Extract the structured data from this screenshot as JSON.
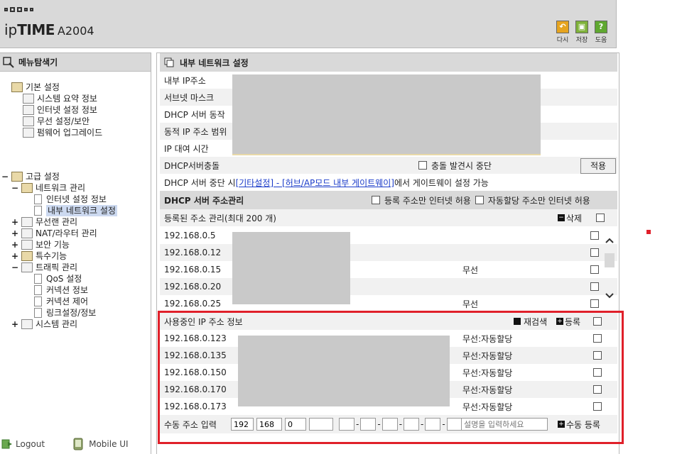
{
  "header": {
    "logo_prefix": "ip",
    "logo_bold": "TIME",
    "model": "A2004",
    "toolbar": [
      {
        "label": "다시",
        "icon": "back-icon",
        "color": "#e6a41f"
      },
      {
        "label": "저장",
        "icon": "save-icon",
        "color": "#7fb23a"
      },
      {
        "label": "도움",
        "icon": "help-icon",
        "color": "#5fa830"
      }
    ]
  },
  "sidebar": {
    "title": "메뉴탐색기",
    "basic": {
      "label": "기본 설정",
      "items": [
        "시스템 요약 정보",
        "인터넷 설정 정보",
        "무선 설정/보안",
        "펌웨어 업그레이드"
      ]
    },
    "advanced": {
      "label": "고급 설정",
      "network": "네트워크 관리",
      "network_items": [
        "인터넷 설정 정보",
        "내부 네트워크 설정"
      ],
      "groups": [
        "무선랜 관리",
        "NAT/라우터 관리",
        "보안 기능",
        "특수기능"
      ],
      "traffic": "트래픽 관리",
      "traffic_items": [
        "QoS 설정",
        "커넥션 정보",
        "커넥션 제어",
        "링크설정/정보"
      ],
      "system": "시스템 관리"
    },
    "footer": {
      "logout": "Logout",
      "mobile": "Mobile UI"
    }
  },
  "main": {
    "title": "내부 네트워크 설정",
    "fields": [
      "내부 IP주소",
      "서브넷 마스크",
      "DHCP 서버 동작",
      "동적 IP 주소 범위",
      "IP 대여 시간"
    ],
    "conflict_label": "DHCP서버충돌",
    "conflict_check": "충돌 발견시 중단",
    "apply": "적용",
    "stop_prefix": "DHCP 서버 중단 시 ",
    "stop_link": "[기타설정] - [허브/AP모드 내부 게이트웨이]",
    "stop_suffix": " 에서 게이트웨이 설정 가능",
    "dhcp_section": "DHCP 서버 주소관리",
    "only_registered": "등록 주소만 인터넷 허용",
    "only_auto": "자동할당 주소만 인터넷 허용",
    "registered_label": "등록된 주소 관리(최대 200 개)",
    "delete": "삭제",
    "registered": [
      {
        "ip": "192.168.0.5",
        "type": ""
      },
      {
        "ip": "192.168.0.12",
        "type": ""
      },
      {
        "ip": "192.168.0.15",
        "type": "무선"
      },
      {
        "ip": "192.168.0.20",
        "type": ""
      },
      {
        "ip": "192.168.0.25",
        "type": "무선"
      }
    ],
    "inuse_label": "사용중인 IP 주소 정보",
    "rescan": "재검색",
    "register": "등록",
    "inuse": [
      {
        "ip": "192.168.0.123",
        "type": "무선:자동할당"
      },
      {
        "ip": "192.168.0.135",
        "type": "무선:자동할당"
      },
      {
        "ip": "192.168.0.150",
        "type": "무선:자동할당"
      },
      {
        "ip": "192.168.0.170",
        "type": "무선:자동할당"
      },
      {
        "ip": "192.168.0.173",
        "type": "무선:자동할당"
      }
    ],
    "manual_label": "수동 주소 입력",
    "manual_ip": [
      "192",
      "168",
      "0",
      ""
    ],
    "desc_placeholder": "설명을 입력하세요",
    "manual_register": "수동 등록"
  }
}
